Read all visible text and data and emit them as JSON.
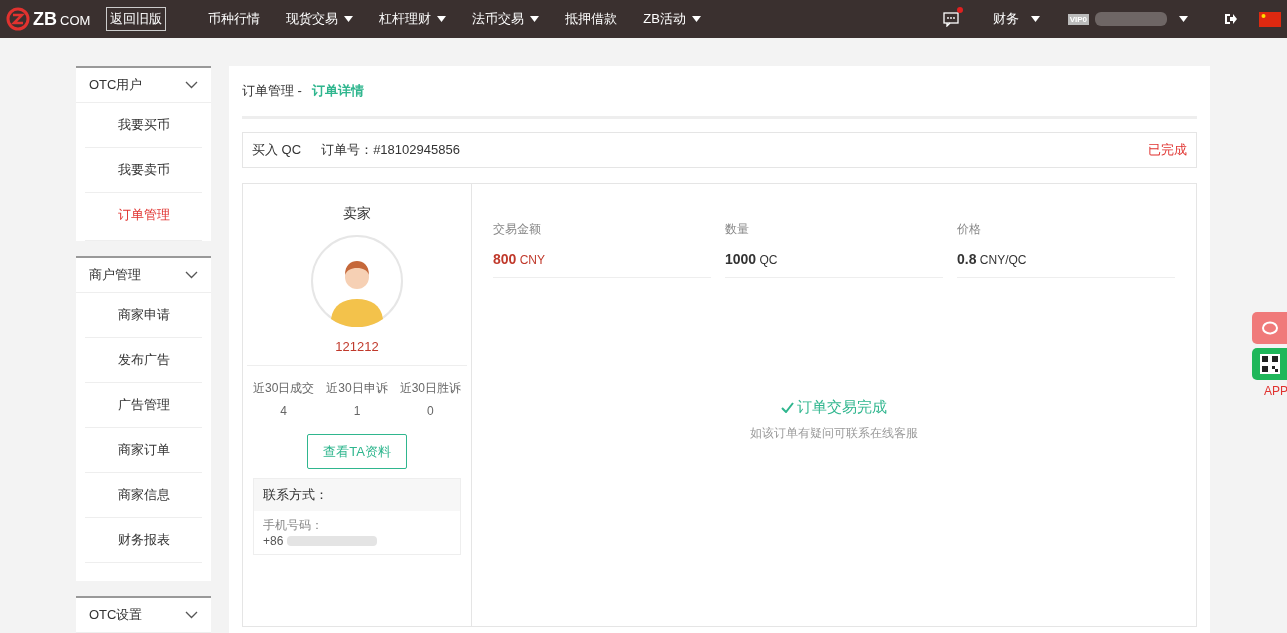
{
  "topbar": {
    "logo": "ZB",
    "logo_suffix": "COM",
    "old_version": "返回旧版",
    "nav": [
      {
        "label": "币种行情",
        "dropdown": false
      },
      {
        "label": "现货交易",
        "dropdown": true
      },
      {
        "label": "杠杆理财",
        "dropdown": true
      },
      {
        "label": "法币交易",
        "dropdown": true
      },
      {
        "label": "抵押借款",
        "dropdown": false
      },
      {
        "label": "ZB活动",
        "dropdown": true
      }
    ],
    "message_unread": true,
    "finance": "财务",
    "vip": "VIP0"
  },
  "sidebar": [
    {
      "title": "OTC用户",
      "items": [
        {
          "label": "我要买币",
          "selected": false
        },
        {
          "label": "我要卖币",
          "selected": false
        },
        {
          "label": "订单管理",
          "selected": true
        }
      ]
    },
    {
      "title": "商户管理",
      "items": [
        {
          "label": "商家申请",
          "selected": false
        },
        {
          "label": "发布广告",
          "selected": false
        },
        {
          "label": "广告管理",
          "selected": false
        },
        {
          "label": "商家订单",
          "selected": false
        },
        {
          "label": "商家信息",
          "selected": false
        },
        {
          "label": "财务报表",
          "selected": false
        }
      ]
    },
    {
      "title": "OTC设置"
    }
  ],
  "breadcrumb": {
    "parent": "订单管理 -",
    "current": "订单详情"
  },
  "order": {
    "type": "买入 QC",
    "number": "订单号：#18102945856",
    "status": "已完成"
  },
  "seller": {
    "title": "卖家",
    "name": "121212",
    "stats": [
      {
        "label": "近30日成交",
        "value": "4"
      },
      {
        "label": "近30日申诉",
        "value": "1"
      },
      {
        "label": "近30日胜诉",
        "value": "0"
      }
    ],
    "profile_button": "查看TA资料",
    "contact_title": "联系方式：",
    "phone_label": "手机号码：",
    "phone_prefix": "+86"
  },
  "details": [
    {
      "label": "交易金额",
      "value": "800",
      "unit": "CNY",
      "highlight": true
    },
    {
      "label": "数量",
      "value": "1000",
      "unit": "QC",
      "highlight": false
    },
    {
      "label": "价格",
      "value": "0.8",
      "unit": "CNY/QC",
      "highlight": false
    }
  ],
  "result": {
    "title": "订单交易完成",
    "hint": "如该订单有疑问可联系在线客服"
  },
  "side_widget": {
    "app_label": "APP"
  }
}
